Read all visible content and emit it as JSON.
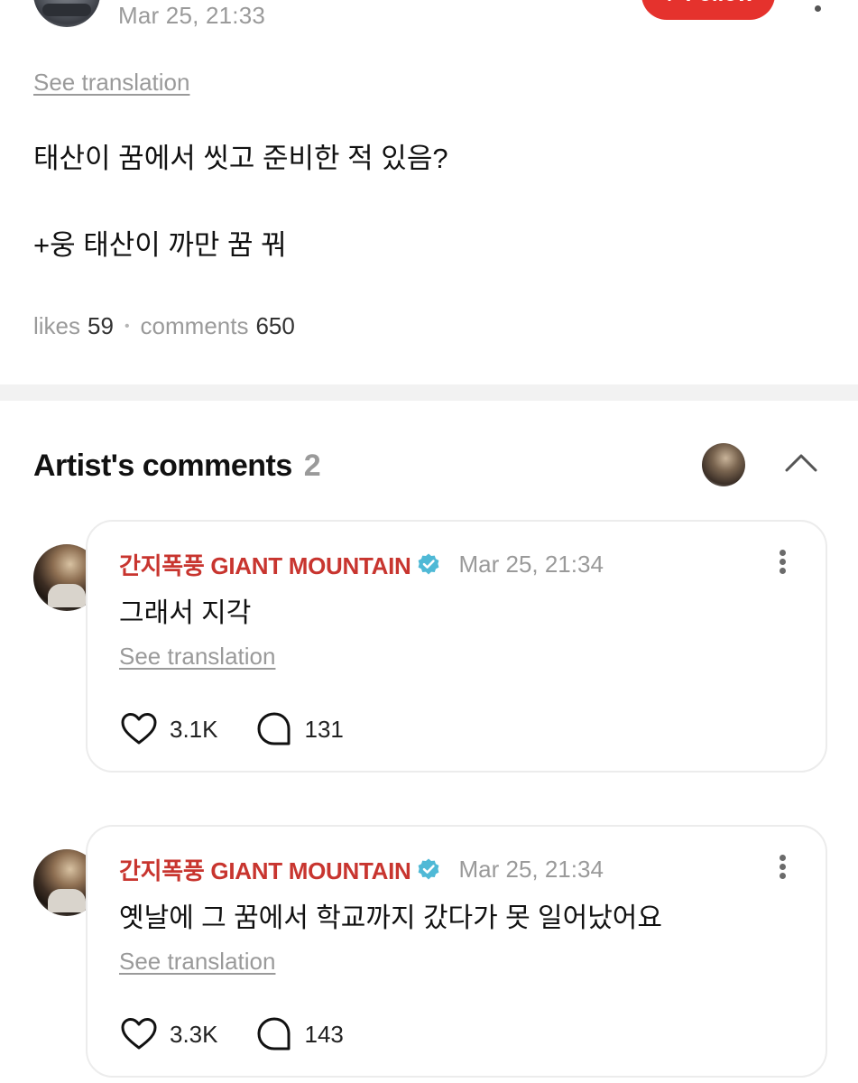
{
  "post": {
    "date": "Mar 25, 21:33",
    "follow_label": "Follow",
    "see_translation": "See translation",
    "body_line1": "태산이 꿈에서 씻고 준비한 적 있음?",
    "body_line2": "+웅 태산이 까만 꿈 꿔",
    "likes_label": "likes",
    "likes_count": "59",
    "comments_label": "comments",
    "comments_count": "650"
  },
  "artist_comments": {
    "title": "Artist's comments",
    "count": "2",
    "items": [
      {
        "author": "간지폭풍 GIANT MOUNTAIN",
        "date": "Mar 25, 21:34",
        "text": "그래서 지각",
        "see_translation": "See translation",
        "likes": "3.1K",
        "replies": "131"
      },
      {
        "author": "간지폭풍 GIANT MOUNTAIN",
        "date": "Mar 25, 21:34",
        "text": "옛날에 그 꿈에서 학교까지 갔다가 못 일어났어요",
        "see_translation": "See translation",
        "likes": "3.3K",
        "replies": "143"
      }
    ]
  },
  "colors": {
    "accent": "#e5322d",
    "author": "#c8352f",
    "verified": "#4fb9d6",
    "muted": "#9a9a9a"
  },
  "icons": [
    "three-dots-icon",
    "chevron-up-icon",
    "verified-badge-icon",
    "heart-icon",
    "reply-bubble-icon",
    "plus-icon"
  ]
}
